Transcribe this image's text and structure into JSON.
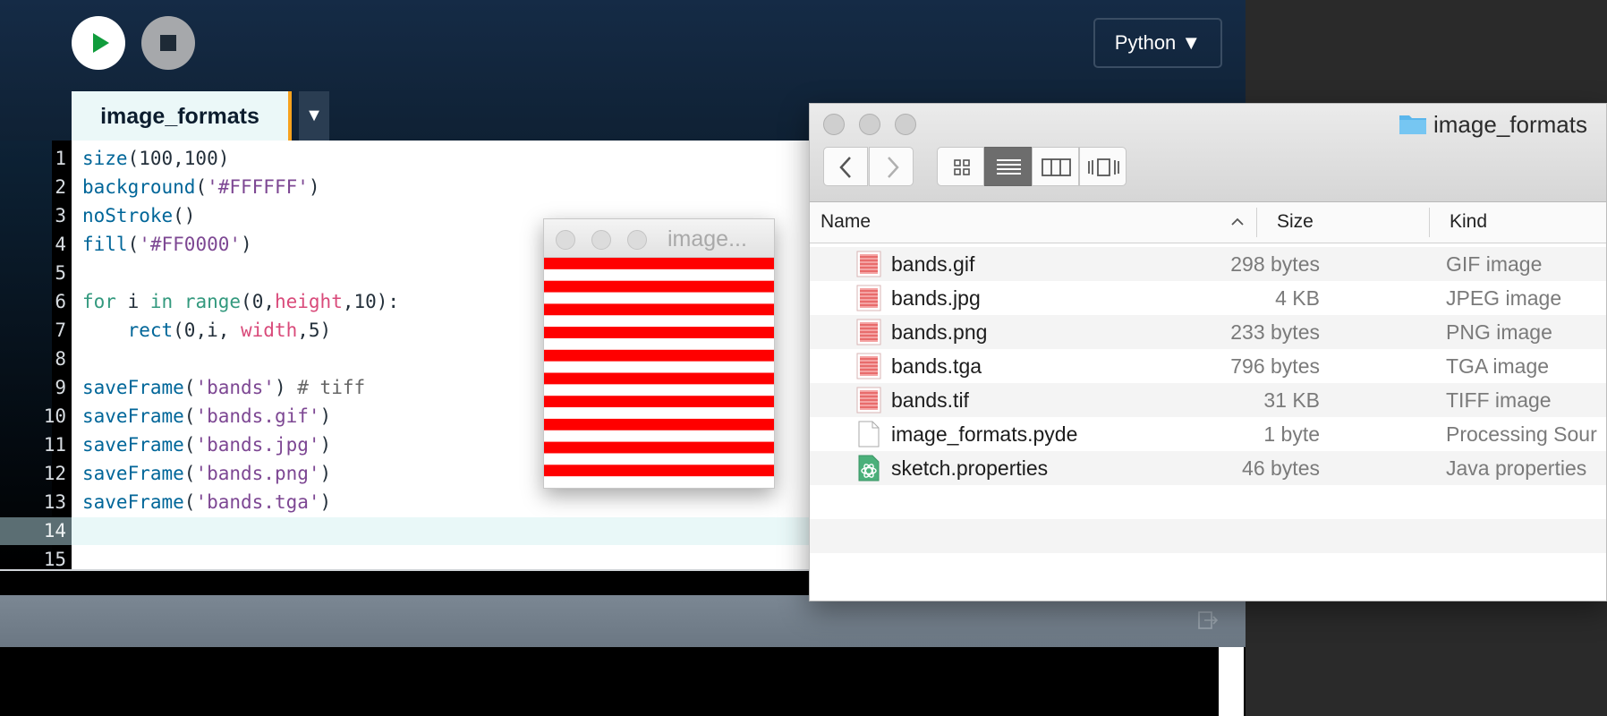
{
  "ide": {
    "run_button": "run",
    "stop_button": "stop",
    "mode_label": "Python ▼",
    "tab_label": "image_formats",
    "tab_menu": "▼",
    "line_numbers": [
      "1",
      "2",
      "3",
      "4",
      "5",
      "6",
      "7",
      "8",
      "9",
      "10",
      "11",
      "12",
      "13",
      "14",
      "15"
    ],
    "code_lines": [
      "size(100,100)",
      "background('#FFFFFF')",
      "noStroke()",
      "fill('#FF0000')",
      "",
      "for i in range(0,height,10):",
      "    rect(0,i, width,5)",
      "",
      "saveFrame('bands') # tiff",
      "saveFrame('bands.gif')",
      "saveFrame('bands.jpg')",
      "saveFrame('bands.png')",
      "saveFrame('bands.tga')",
      "",
      ""
    ],
    "current_line": "14"
  },
  "sketch_window": {
    "title": "image...",
    "stripe_color": "#FF0000",
    "background_color": "#FFFFFF"
  },
  "finder": {
    "title": "image_formats",
    "columns": {
      "name": "Name",
      "size": "Size",
      "kind": "Kind",
      "sort_indicator": "^"
    },
    "files": [
      {
        "name": "bands.gif",
        "size": "298 bytes",
        "kind": "GIF image",
        "icon": "image-icon"
      },
      {
        "name": "bands.jpg",
        "size": "4 KB",
        "kind": "JPEG image",
        "icon": "image-icon"
      },
      {
        "name": "bands.png",
        "size": "233 bytes",
        "kind": "PNG image",
        "icon": "image-icon"
      },
      {
        "name": "bands.tga",
        "size": "796 bytes",
        "kind": "TGA image",
        "icon": "image-icon"
      },
      {
        "name": "bands.tif",
        "size": "31 KB",
        "kind": "TIFF image",
        "icon": "image-icon"
      },
      {
        "name": "image_formats.pyde",
        "size": "1 byte",
        "kind": "Processing Sour",
        "icon": "document-icon"
      },
      {
        "name": "sketch.properties",
        "size": "46 bytes",
        "kind": "Java properties",
        "icon": "java-properties-icon"
      }
    ]
  }
}
